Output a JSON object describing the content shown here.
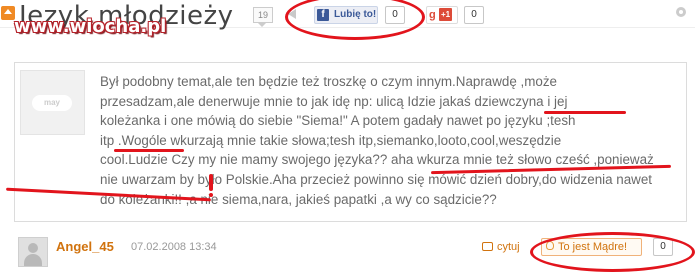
{
  "header": {
    "title": "Jezyk młodzieży",
    "watermark": "www.wiocha.pl",
    "comment_count": "19",
    "facebook": {
      "like_label": "Lubię to!",
      "count": "0"
    },
    "google_plus": {
      "g_label": "g",
      "plus_label": "+1",
      "count": "0"
    }
  },
  "post": {
    "avatar_text": "may",
    "lines": [
      "Był podobny temat,ale ten będzie też troszkę o czym innym.Naprawdę ,może",
      "przesadzam,ale denerwuje mnie to jak idę np: ulicą Idzie jakaś dziewczyna i jej",
      "koleżanka i one mówią do siebie \"Siema!\" A potem gadały nawet po języku ;tesh",
      "itp .Wogóle wkurzają mnie takie słowa;tesh itp,siemanko,looto,cool,weszędzie",
      "cool.Ludzie Czy my nie mamy swojego języka?? aha wkurza mnie też słowo cześć ,ponieważ",
      "nie uwarzam by było Polskie.Aha przecież powinno się mówić dzień dobry,do widzenia nawet",
      "do koleżanki!! ,a nie siema,nara, jakieś papatki ,a wy co sądzicie??"
    ]
  },
  "footer": {
    "username": "Angel_45",
    "timestamp": "07.02.2008 13:34",
    "quote_label": "cytuj",
    "madre_label": "To jest Mądre!",
    "madre_count": "0"
  },
  "colors": {
    "accent": "#d1730e",
    "annotation_red": "#e2141c",
    "facebook": "#3b5998",
    "google": "#dd4b39"
  }
}
